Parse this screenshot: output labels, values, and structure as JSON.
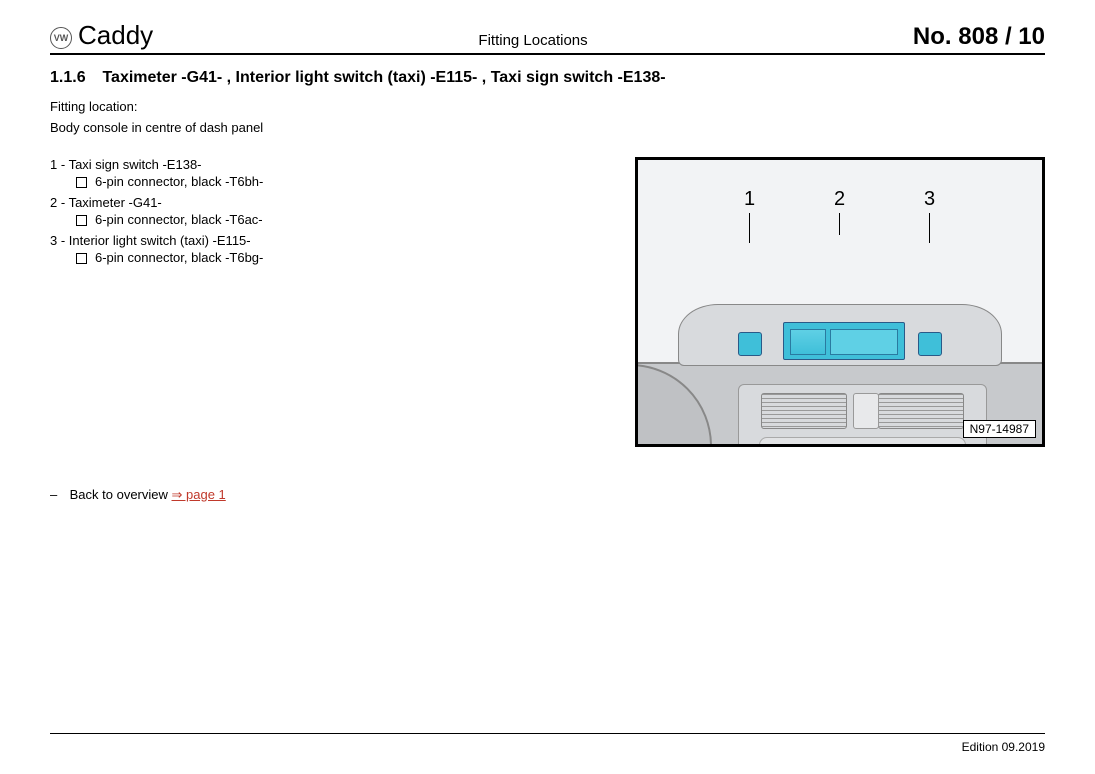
{
  "header": {
    "model": "Caddy",
    "center": "Fitting Locations",
    "pageno": "No.  808 /  10"
  },
  "section": {
    "number": "1.1.6",
    "title": "Taximeter -G41- , Interior light switch (taxi) -E115- , Taxi sign switch -E138-"
  },
  "fitloc_label": "Fitting location:",
  "fitloc_desc": "Body console in centre of dash panel",
  "items": [
    {
      "num": "1",
      "text": "Taxi sign switch -E138-",
      "sub": "6-pin connector, black -T6bh-"
    },
    {
      "num": "2",
      "text": "Taximeter -G41-",
      "sub": "6-pin connector, black -T6ac-"
    },
    {
      "num": "3",
      "text": "Interior light switch (taxi) -E115-",
      "sub": "6-pin connector, black -T6bg-"
    }
  ],
  "callouts": {
    "c1": "1",
    "c2": "2",
    "c3": "3"
  },
  "image_id": "N97-14987",
  "backlink": {
    "prefix": "Back to overview ",
    "link": "⇒ page 1"
  },
  "edition": "Edition  09.2019"
}
